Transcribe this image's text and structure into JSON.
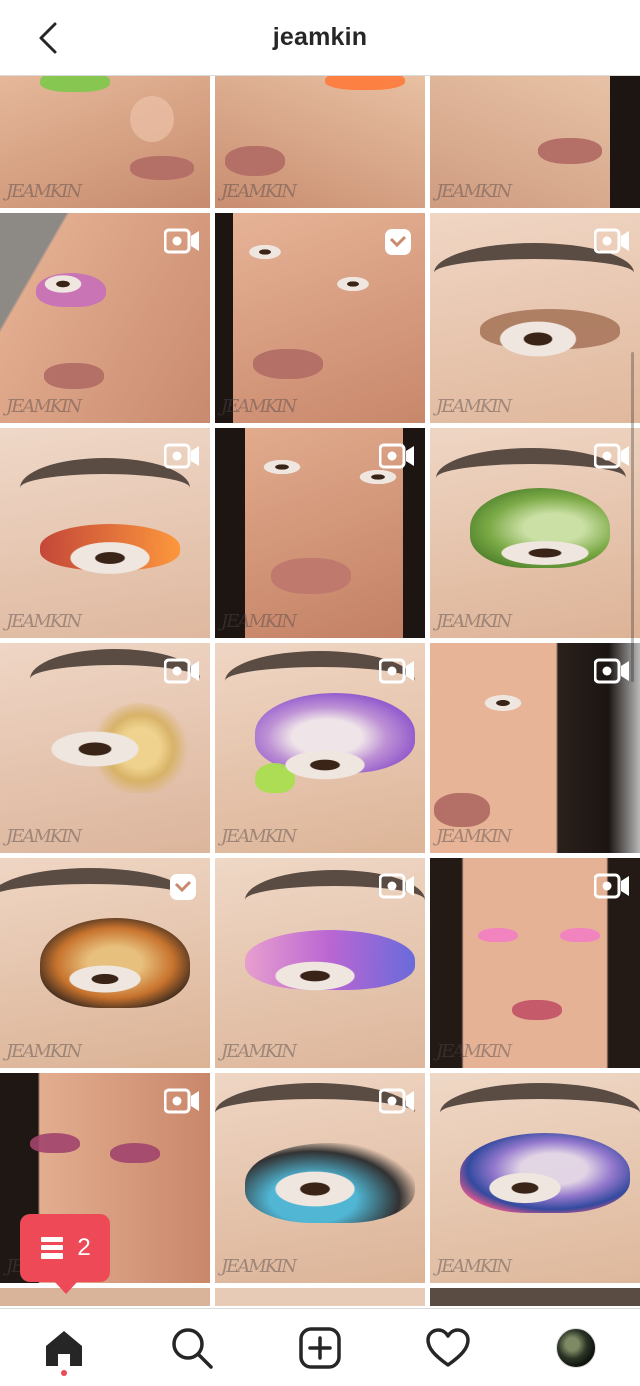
{
  "header": {
    "title": "jeamkin",
    "back_icon": "chevron-left-icon"
  },
  "watermark": "JEAMKIN",
  "colors": {
    "accent": "#ed4956",
    "text": "#262626",
    "divider": "#dbdbdb"
  },
  "grid": {
    "tiles": [
      {
        "kind": "face",
        "type": "none"
      },
      {
        "kind": "face",
        "type": "none"
      },
      {
        "kind": "face",
        "type": "none"
      },
      {
        "kind": "face",
        "type": "video"
      },
      {
        "kind": "face",
        "type": "igtv"
      },
      {
        "kind": "eye",
        "type": "video"
      },
      {
        "kind": "eye",
        "type": "video"
      },
      {
        "kind": "face",
        "type": "video"
      },
      {
        "kind": "eye",
        "type": "video"
      },
      {
        "kind": "eye",
        "type": "video"
      },
      {
        "kind": "eye",
        "type": "video"
      },
      {
        "kind": "face",
        "type": "video"
      },
      {
        "kind": "eye",
        "type": "igtv"
      },
      {
        "kind": "eye",
        "type": "video"
      },
      {
        "kind": "face",
        "type": "video"
      },
      {
        "kind": "face",
        "type": "video"
      },
      {
        "kind": "eye",
        "type": "video"
      },
      {
        "kind": "eye",
        "type": "none"
      }
    ]
  },
  "notification": {
    "icon": "comment-stack-icon",
    "count": "2"
  },
  "bottom_nav": [
    {
      "name": "home",
      "icon": "home-icon",
      "active": true
    },
    {
      "name": "search",
      "icon": "search-icon",
      "active": false
    },
    {
      "name": "new-post",
      "icon": "plus-square-icon",
      "active": false
    },
    {
      "name": "activity",
      "icon": "heart-icon",
      "active": false
    },
    {
      "name": "profile",
      "icon": "avatar",
      "active": false
    }
  ]
}
